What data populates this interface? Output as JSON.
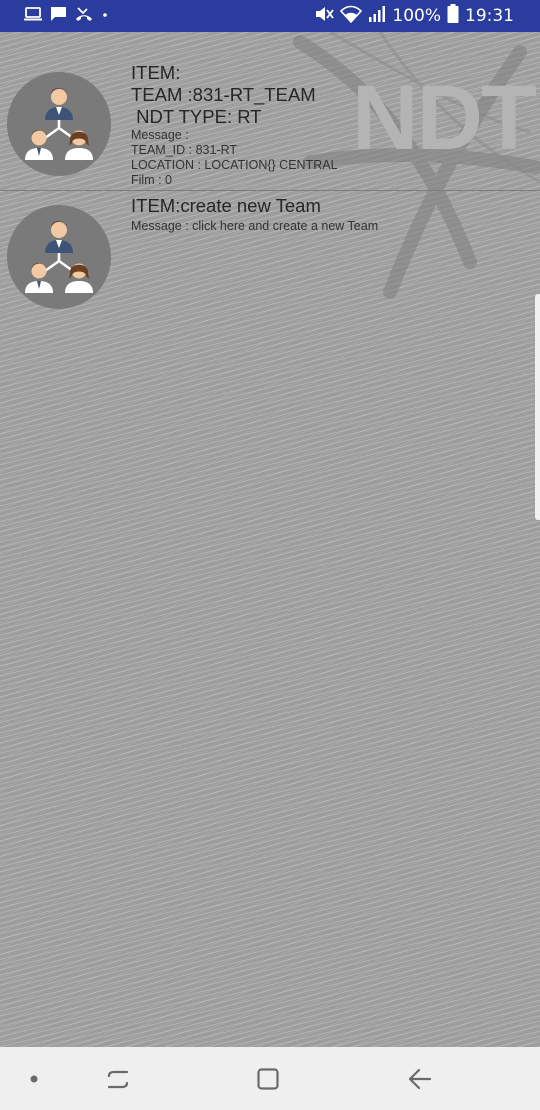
{
  "status_bar": {
    "battery_percent": "100%",
    "time": "19:31",
    "icons": [
      "laptop-icon",
      "message-icon",
      "missed-call-icon",
      "dot-icon",
      "mute-icon",
      "wifi-icon",
      "signal-icon",
      "battery-icon"
    ]
  },
  "background": {
    "logo_text": "NDT"
  },
  "list": [
    {
      "item": "ITEM:",
      "team": "TEAM :831-RT_TEAM",
      "ndt_type": " NDT TYPE: RT",
      "message": "Message :",
      "team_id": "TEAM_ID : 831-RT",
      "location": "LOCATION : LOCATION{} CENTRAL",
      "film": "Film : 0",
      "icon": "team-group-icon"
    },
    {
      "item": "ITEM:create new Team",
      "message": "Message : click here and create a new Team",
      "icon": "team-group-icon"
    }
  ],
  "nav_bar": {
    "buttons": [
      "dot-icon",
      "recent-apps-icon",
      "home-icon",
      "back-icon"
    ]
  },
  "colors": {
    "status_bar": "#2a3d9e",
    "background": "#9d9d9d",
    "avatar_circle": "#7a7a7a",
    "nav_bar": "#efefef"
  }
}
